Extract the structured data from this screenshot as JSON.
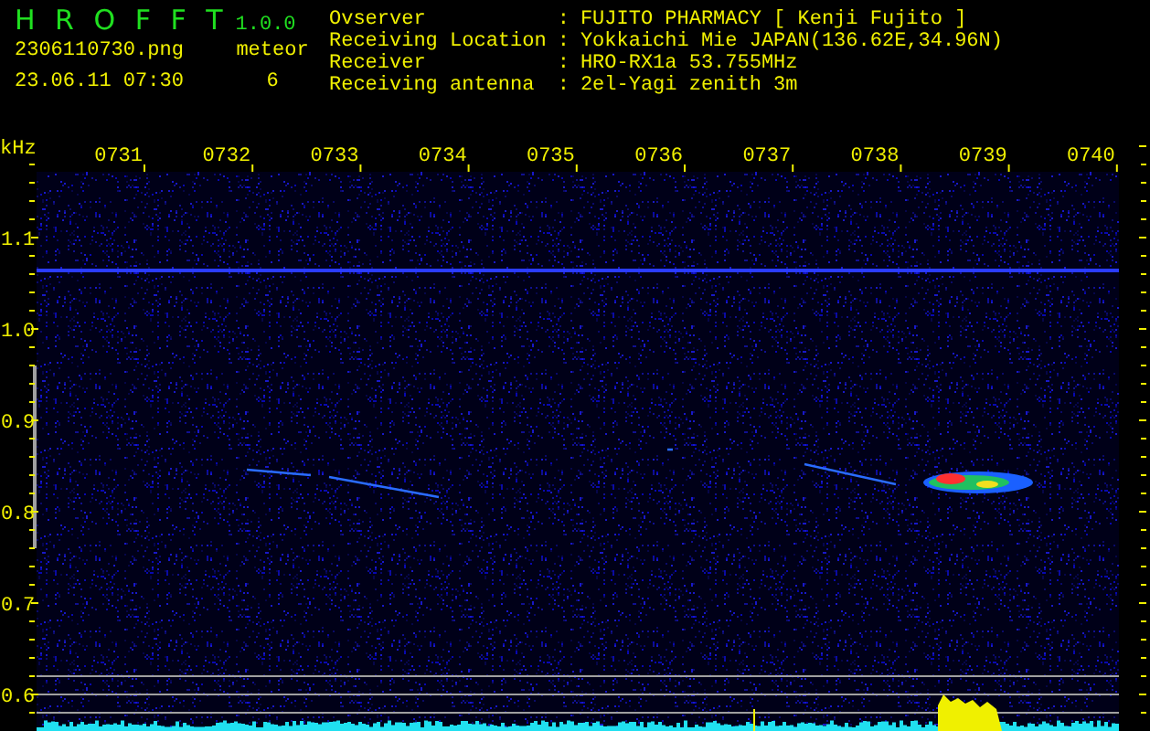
{
  "app": {
    "title": "H R O F F T",
    "version": "1.0.0"
  },
  "file": {
    "name": "2306110730.png",
    "timestamp": "23.06.11 07:30"
  },
  "count": {
    "label": "meteor",
    "value": "6"
  },
  "station": [
    {
      "label": "Ovserver",
      "colon": ":",
      "value": "FUJITO PHARMACY [ Kenji Fujito ]"
    },
    {
      "label": "Receiving Location",
      "colon": ":",
      "value": "Yokkaichi Mie JAPAN(136.62E,34.96N)"
    },
    {
      "label": "Receiver",
      "colon": ":",
      "value": "HRO-RX1a 53.755MHz"
    },
    {
      "label": "Receiving antenna",
      "colon": ":",
      "value": "2el-Yagi zenith 3m"
    }
  ],
  "spectrogram": {
    "unit": "kHz",
    "time_labels": [
      "0731",
      "0732",
      "0733",
      "0734",
      "0735",
      "0736",
      "0737",
      "0738",
      "0739",
      "0740"
    ],
    "freq_labels": [
      "1.1",
      "1.0",
      "0.9",
      "0.8",
      "0.7",
      "0.6"
    ]
  }
}
